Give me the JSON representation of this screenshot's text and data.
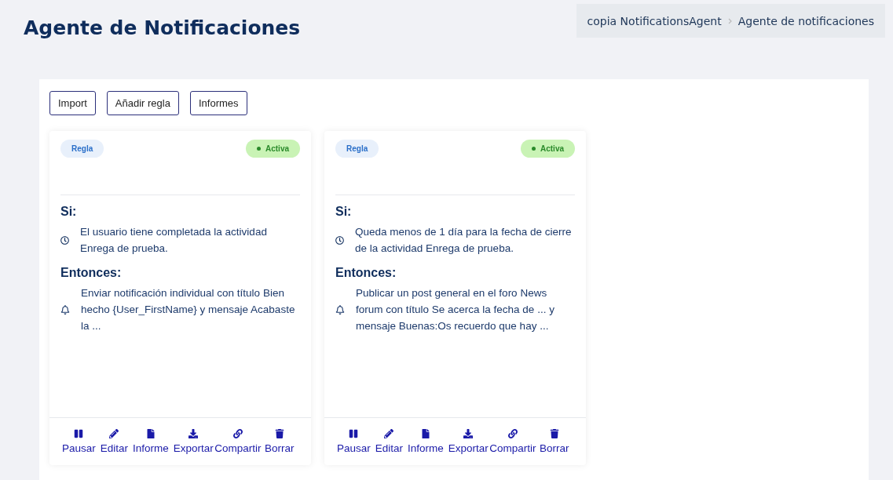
{
  "page_title": "Agente de Notificaciones",
  "breadcrumb": [
    "copia NotificationsAgent",
    "Agente de notificaciones"
  ],
  "toolbar": [
    "Import",
    "Añadir regla",
    "Informes"
  ],
  "cards": [
    {
      "tag": "Regla",
      "status": {
        "kind": "active",
        "label": "Activa"
      },
      "if_label": "Si:",
      "condition": "El usuario tiene completada la actividad Enrega de prueba.",
      "then_label": "Entonces:",
      "action": "Enviar notificación individual con título Bien hecho {User_FirstName} y mensaje Acabaste la ...",
      "buttons": [
        {
          "kind": "pause",
          "label": "Pausar"
        },
        {
          "kind": "edit",
          "label": "Editar"
        },
        {
          "kind": "report",
          "label": "Informe"
        },
        {
          "kind": "export",
          "label": "Exportar"
        },
        {
          "kind": "share",
          "label": "Compartir"
        },
        {
          "kind": "delete",
          "label": "Borrar"
        }
      ]
    },
    {
      "tag": "Regla",
      "status": {
        "kind": "active",
        "label": "Activa"
      },
      "if_label": "Si:",
      "condition": "Queda menos de 1 día para la fecha de cierre de la actividad Enrega de prueba.",
      "then_label": "Entonces:",
      "action": "Publicar un post general en el foro News forum con título Se acerca la fecha de ... y mensaje Buenas:Os recuerdo que hay ...",
      "buttons": [
        {
          "kind": "pause",
          "label": "Pausar"
        },
        {
          "kind": "edit",
          "label": "Editar"
        },
        {
          "kind": "report",
          "label": "Informe"
        },
        {
          "kind": "export",
          "label": "Exportar"
        },
        {
          "kind": "share",
          "label": "Compartir"
        },
        {
          "kind": "delete",
          "label": "Borrar"
        }
      ]
    }
  ]
}
